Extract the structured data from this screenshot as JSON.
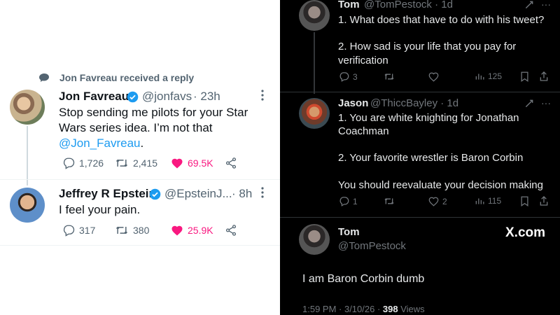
{
  "left": {
    "reply_header": "Jon Favreau received a reply",
    "tweet1": {
      "name": "Jon Favreau",
      "handle": "@jonfavs",
      "time": "· 23h",
      "text_line1": "Stop sending me pilots for your Star",
      "text_line2": "Wars series idea. I’m not that",
      "mention": "@Jon_Favreau",
      "mention_suffix": ".",
      "replies": "1,726",
      "retweets": "2,415",
      "likes": "69.5K"
    },
    "tweet2": {
      "name": "Jeffrey R Epstein",
      "handle": "@EpsteinJ...",
      "time": "· 8h",
      "text": "I feel your pain.",
      "replies": "317",
      "retweets": "380",
      "likes": "25.9K"
    },
    "colors": {
      "link": "#1d9bf0",
      "like": "#f91880",
      "verified": "#1d9bf0"
    }
  },
  "right": {
    "tom1": {
      "name": "Tom",
      "handle": "@TomPestock · 1d",
      "line1": "1. What does that have to do with his tweet?",
      "line2": "2.  How sad is your life that you pay for",
      "line3": "verification",
      "replies": "3",
      "views": "125"
    },
    "jason": {
      "name": "Jason",
      "handle": "@ThiccBayley · 1d",
      "line1": "1. You are white knighting for Jonathan",
      "line2": "Coachman",
      "line3": "2. Your favorite wrestler is Baron Corbin",
      "line4": "You should reevaluate your decision making",
      "replies": "1",
      "likes": "2",
      "views": "115"
    },
    "tom2": {
      "name": "Tom",
      "handle": "@TomPestock",
      "watermark": "X.com",
      "text": "I am Baron Corbin dumb",
      "meta_time": "1:59 PM · 3/10/26 ·",
      "meta_views_count": "398",
      "meta_views_label": "Views"
    }
  }
}
